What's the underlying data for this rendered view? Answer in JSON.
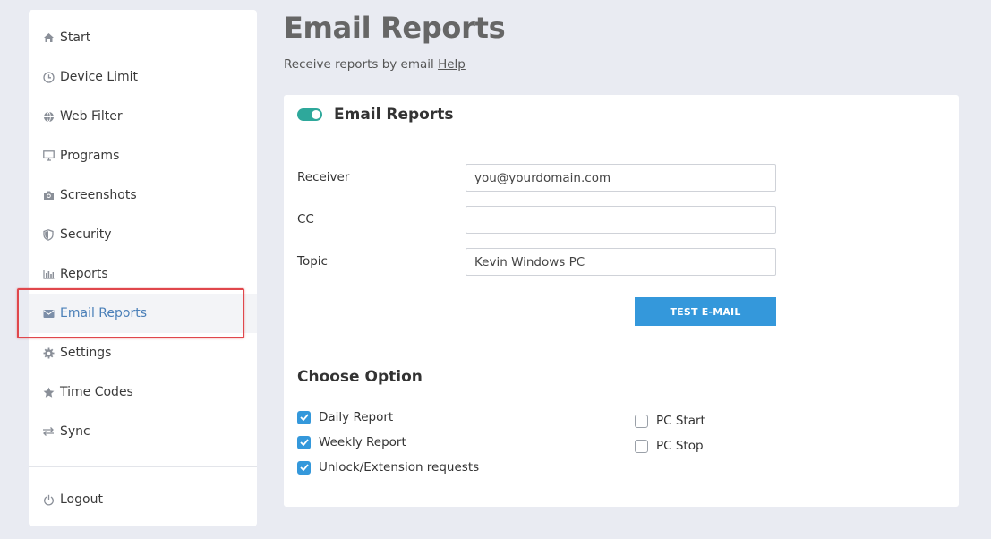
{
  "sidebar": {
    "items": [
      {
        "label": "Start",
        "icon": "home-icon"
      },
      {
        "label": "Device Limit",
        "icon": "clock-icon"
      },
      {
        "label": "Web Filter",
        "icon": "globe-icon"
      },
      {
        "label": "Programs",
        "icon": "monitor-icon"
      },
      {
        "label": "Screenshots",
        "icon": "camera-icon"
      },
      {
        "label": "Security",
        "icon": "shield-icon"
      },
      {
        "label": "Reports",
        "icon": "bar-chart-icon"
      },
      {
        "label": "Email Reports",
        "icon": "envelope-icon"
      },
      {
        "label": "Settings",
        "icon": "gear-icon"
      },
      {
        "label": "Time Codes",
        "icon": "star-icon"
      },
      {
        "label": "Sync",
        "icon": "sync-arrows-icon"
      }
    ],
    "logout_label": "Logout",
    "active_item": "Email Reports"
  },
  "header": {
    "title": "Email Reports",
    "subtitle": "Receive reports by email",
    "help_link": "Help"
  },
  "card": {
    "title": "Email Reports",
    "toggle_on": true,
    "fields": {
      "receiver": {
        "label": "Receiver",
        "value": "you@yourdomain.com"
      },
      "cc": {
        "label": "CC",
        "value": ""
      },
      "topic": {
        "label": "Topic",
        "value": "Kevin Windows PC"
      }
    },
    "test_button_label": "TEST E-MAIL",
    "options_title": "Choose Option",
    "options": {
      "daily": {
        "label": "Daily Report",
        "checked": true
      },
      "weekly": {
        "label": "Weekly Report",
        "checked": true
      },
      "unlock": {
        "label": "Unlock/Extension requests",
        "checked": true
      },
      "pc_start": {
        "label": "PC Start",
        "checked": false
      },
      "pc_stop": {
        "label": "PC Stop",
        "checked": false
      }
    }
  },
  "colors": {
    "accent": "#3498db",
    "toggle": "#2ea89b",
    "active_text": "#4a7fb8",
    "highlight": "#e0474c",
    "background": "#e9ebf2"
  }
}
